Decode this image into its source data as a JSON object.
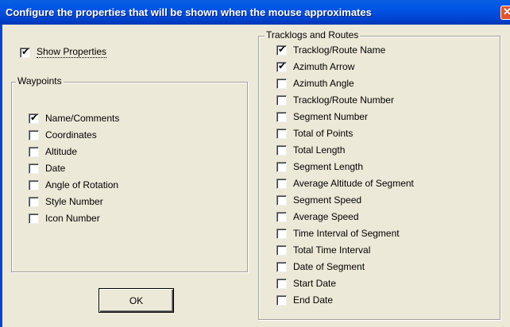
{
  "window": {
    "title": "Configure the properties that will be shown when the mouse approximates",
    "close_glyph": "✕"
  },
  "show_properties": {
    "label": "Show Properties",
    "checked": true
  },
  "waypoints": {
    "title": "Waypoints",
    "items": [
      {
        "label": "Name/Comments",
        "checked": true
      },
      {
        "label": "Coordinates",
        "checked": false
      },
      {
        "label": "Altitude",
        "checked": false
      },
      {
        "label": "Date",
        "checked": false
      },
      {
        "label": "Angle of Rotation",
        "checked": false
      },
      {
        "label": "Style Number",
        "checked": false
      },
      {
        "label": "Icon Number",
        "checked": false
      }
    ]
  },
  "tracklogs": {
    "title": "Tracklogs and Routes",
    "items": [
      {
        "label": "Tracklog/Route Name",
        "checked": true
      },
      {
        "label": "Azimuth Arrow",
        "checked": true
      },
      {
        "label": "Azimuth Angle",
        "checked": false
      },
      {
        "label": "Tracklog/Route Number",
        "checked": false
      },
      {
        "label": "Segment Number",
        "checked": false
      },
      {
        "label": "Total of Points",
        "checked": false
      },
      {
        "label": "Total Length",
        "checked": false
      },
      {
        "label": "Segment Length",
        "checked": false
      },
      {
        "label": "Average Altitude of Segment",
        "checked": false
      },
      {
        "label": "Segment Speed",
        "checked": false
      },
      {
        "label": "Average Speed",
        "checked": false
      },
      {
        "label": "Time Interval of Segment",
        "checked": false
      },
      {
        "label": "Total Time Interval",
        "checked": false
      },
      {
        "label": "Date of Segment",
        "checked": false
      },
      {
        "label": "Start Date",
        "checked": false
      },
      {
        "label": "End Date",
        "checked": false
      }
    ]
  },
  "buttons": {
    "ok_label": "OK"
  },
  "checkmark_glyph": "✔"
}
